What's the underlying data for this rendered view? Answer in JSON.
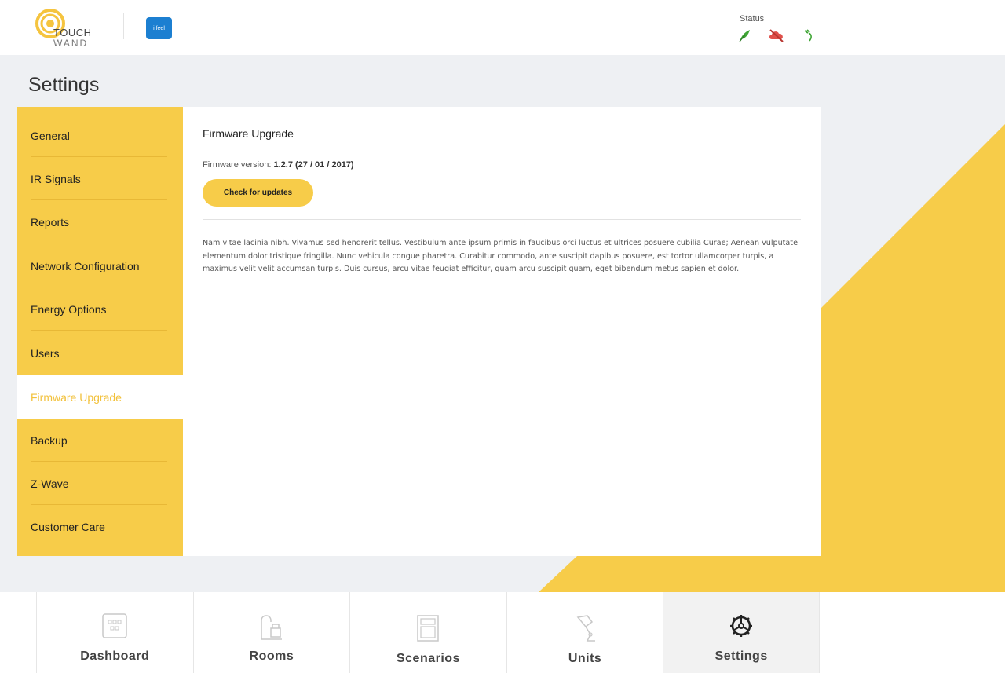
{
  "header": {
    "brand_line1": "TOUCH",
    "brand_line2": "WAND",
    "partner_logo": "i feel",
    "status_label": "Status",
    "status_icons": [
      "leaf-icon",
      "cloud-off-icon",
      "plug-icon"
    ]
  },
  "page": {
    "title": "Settings"
  },
  "sidebar": {
    "items": [
      {
        "label": "General"
      },
      {
        "label": "IR Signals"
      },
      {
        "label": "Reports"
      },
      {
        "label": "Network Configuration"
      },
      {
        "label": "Energy Options"
      },
      {
        "label": "Users"
      },
      {
        "label": "Firmware Upgrade",
        "active": true
      },
      {
        "label": "Backup"
      },
      {
        "label": "Z-Wave"
      },
      {
        "label": "Customer Care"
      }
    ]
  },
  "content": {
    "title": "Firmware Upgrade",
    "version_label": "Firmware version:",
    "version_value": "1.2.7 (27 / 01 / 2017)",
    "check_button": "Check for updates",
    "body_text": "Nam vitae lacinia nibh. Vivamus sed hendrerit tellus. Vestibulum ante ipsum primis in faucibus orci luctus et ultrices posuere cubilia Curae; Aenean vulputate elementum dolor tristique fringilla. Nunc vehicula congue pharetra. Curabitur commodo, ante suscipit dapibus posuere, est tortor ullamcorper turpis, a maximus velit velit accumsan turpis. Duis cursus, arcu vitae feugiat efficitur, quam arcu suscipit quam, eget bibendum metus sapien et dolor."
  },
  "bottom_nav": {
    "items": [
      {
        "label": "Dashboard",
        "icon": "dashboard-icon"
      },
      {
        "label": "Rooms",
        "icon": "rooms-icon"
      },
      {
        "label": "Scenarios",
        "icon": "scenarios-icon"
      },
      {
        "label": "Units",
        "icon": "units-icon"
      },
      {
        "label": "Settings",
        "icon": "gear-icon",
        "active": true
      }
    ]
  },
  "colors": {
    "accent_yellow": "#f7cc49",
    "active_text": "#f2c13b",
    "status_green": "#3fa535",
    "status_red": "#e0504a"
  }
}
